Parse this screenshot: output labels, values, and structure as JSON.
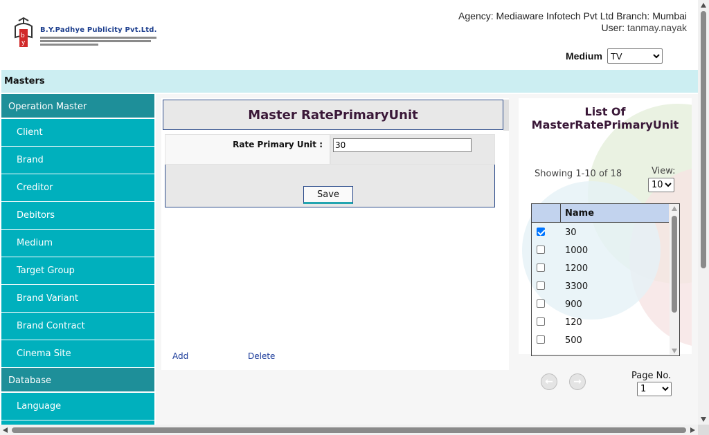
{
  "header": {
    "company_name": "B.Y.Padhye Publicity Pvt.Ltd.",
    "agency_label": "Agency:",
    "agency_name": "Mediaware Infotech Pvt Ltd",
    "branch_label": "Branch:",
    "branch_name": "Mumbai",
    "user_label": "User:",
    "user_name": "tanmay.nayak",
    "medium_label": "Medium",
    "medium_value": "TV"
  },
  "masters_bar": {
    "label": "Masters"
  },
  "sidebar": {
    "sections": [
      {
        "title": "Operation Master",
        "items": [
          "Client",
          "Brand",
          "Creditor",
          "Debitors",
          "Medium",
          "Target Group",
          "Brand Variant",
          "Brand Contract",
          "Cinema Site"
        ]
      },
      {
        "title": "Database",
        "items": [
          "Language"
        ]
      }
    ],
    "colors": {
      "section_bg": "#1e8f99",
      "item_bg": "#00b0bd"
    }
  },
  "form": {
    "title": "Master RatePrimaryUnit",
    "field_label": "Rate Primary Unit :",
    "field_value": "30",
    "save_label": "Save",
    "add_label": "Add",
    "delete_label": "Delete"
  },
  "list": {
    "title": "List Of MasterRatePrimaryUnit",
    "showing": "Showing 1-10 of 18",
    "view_label": "View:",
    "view_value": "10",
    "column_header": "Name",
    "rows": [
      {
        "name": "30",
        "checked": true
      },
      {
        "name": "1000",
        "checked": false
      },
      {
        "name": "1200",
        "checked": false
      },
      {
        "name": "3300",
        "checked": false
      },
      {
        "name": "900",
        "checked": false
      },
      {
        "name": "120",
        "checked": false
      },
      {
        "name": "500",
        "checked": false
      }
    ],
    "page_label": "Page No.",
    "page_value": "1",
    "prev_icon": "arrow-left-icon",
    "next_icon": "arrow-right-icon"
  },
  "colors": {
    "accent": "#00b0bd",
    "title_text": "#3a1838",
    "masters_bar": "#cceef2",
    "grid_header": "#c2d3ee"
  }
}
